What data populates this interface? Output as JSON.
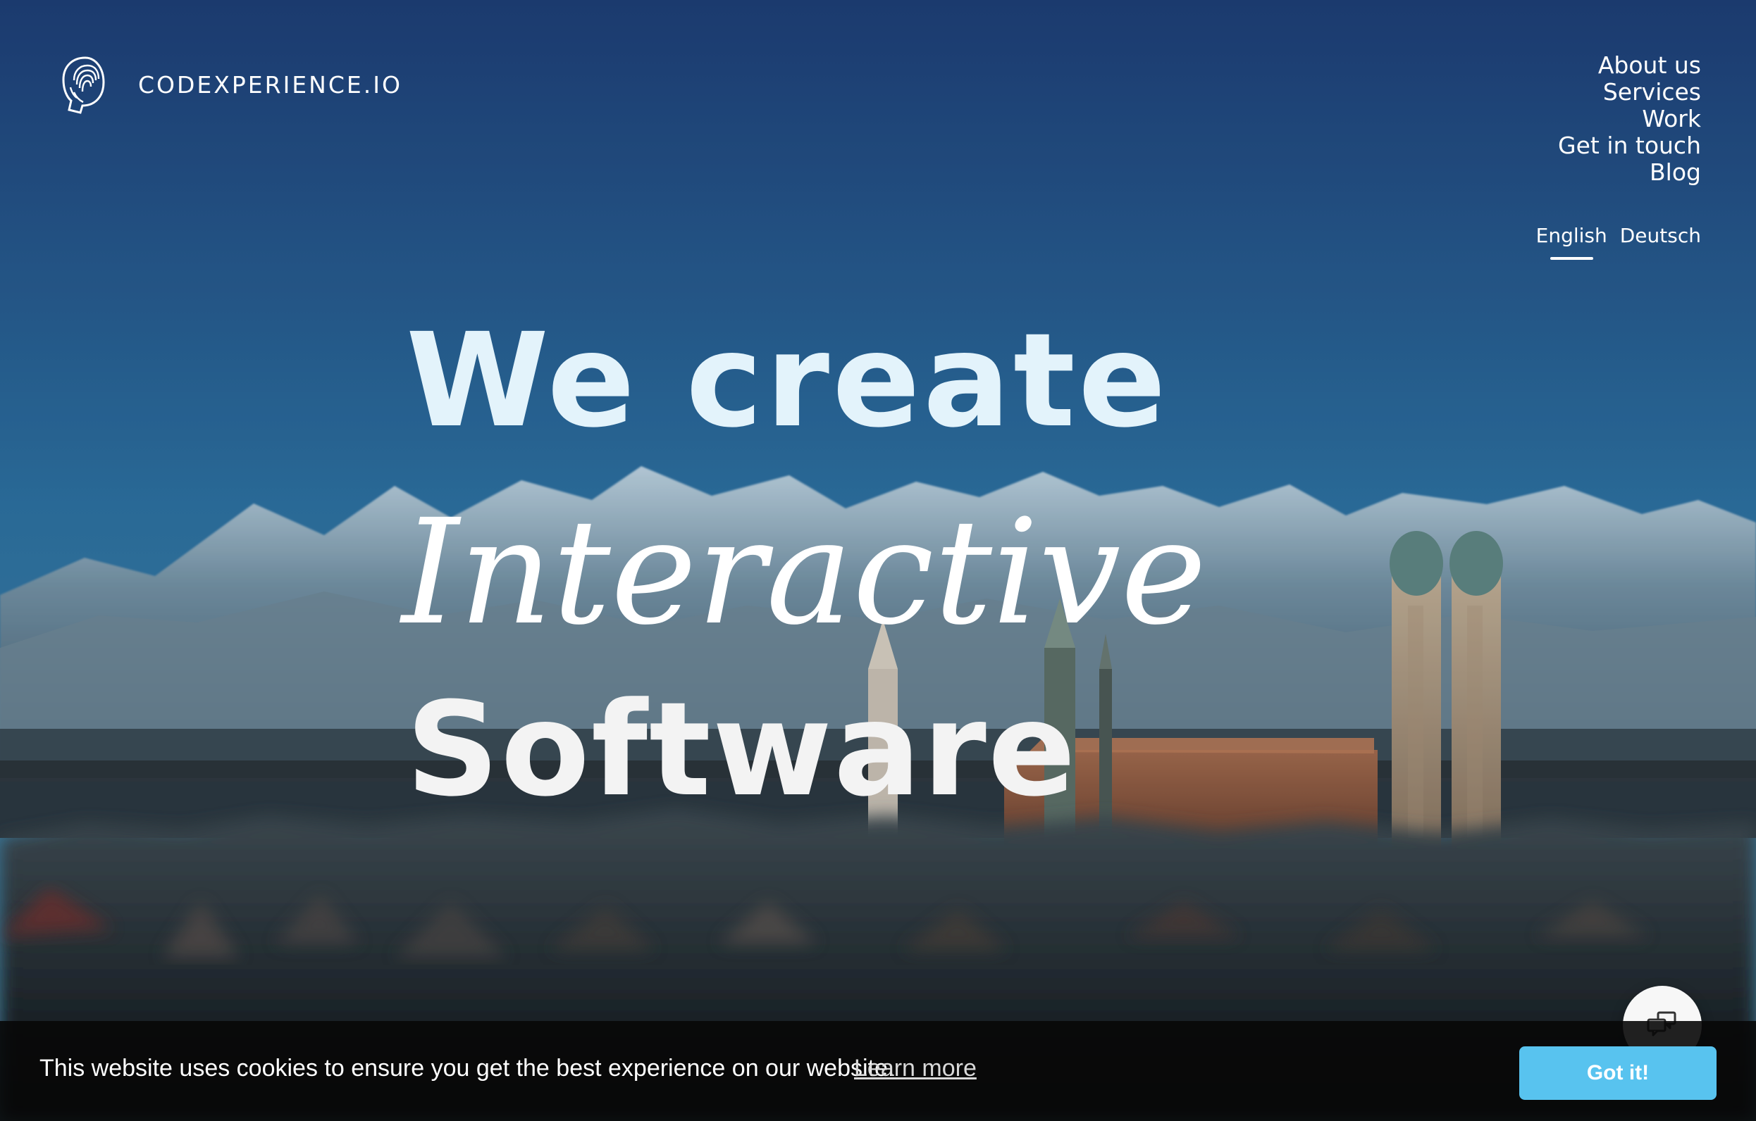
{
  "brand": {
    "name": "CODEXPERIENCE.IO"
  },
  "nav": {
    "items": [
      "About us",
      "Services",
      "Work",
      "Get in touch",
      "Blog"
    ]
  },
  "language": {
    "english": "English",
    "deutsch": "Deutsch",
    "selected": "English"
  },
  "hero": {
    "line1": "We create",
    "line2": "Interactive",
    "line3": "Software"
  },
  "cookie_banner": {
    "message": "This website uses cookies to ensure you get the best experience on our website.",
    "learn_more": "Learn more",
    "accept": "Got it!"
  },
  "colors": {
    "accent": "#58c3ef",
    "cookie_background": "#080808",
    "text": "#ffffff"
  },
  "icons": {
    "logo": "fingerprint-head-icon",
    "chat": "chat-bubbles-icon"
  }
}
